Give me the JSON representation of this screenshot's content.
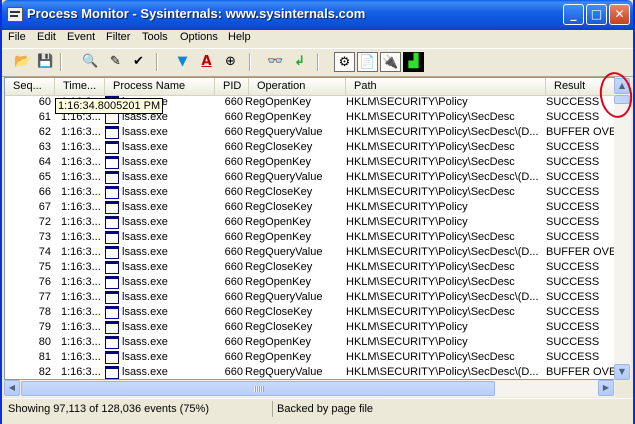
{
  "window": {
    "title": "Process Monitor - Sysinternals: www.sysinternals.com"
  },
  "titlebar": {
    "minimize_glyph": "_",
    "maximize_glyph": "□",
    "close_glyph": "✕"
  },
  "menu": [
    "File",
    "Edit",
    "Event",
    "Filter",
    "Tools",
    "Options",
    "Help"
  ],
  "toolbar": {
    "icons": [
      "open-icon",
      "save-icon",
      "find-icon",
      "highlight-icon",
      "bookmark-icon",
      "filter-icon",
      "highlight-color-icon",
      "target-icon",
      "binoculars-icon",
      "jump-icon",
      "registry-activity-icon",
      "file-activity-icon",
      "network-activity-icon",
      "profiling-activity-icon"
    ],
    "glyphs": [
      "📂",
      "💾",
      "🔍",
      "✎",
      "✔",
      "▼",
      "A",
      "⊕",
      "👓",
      "↲",
      "⚙",
      "📄",
      "🔌",
      "▟"
    ]
  },
  "columns": [
    "Seq...",
    "Time...",
    "Process Name",
    "PID",
    "Operation",
    "Path",
    "Result"
  ],
  "tooltip": "1:16:34.8005201 PM",
  "rows": [
    {
      "seq": "60",
      "time": "1:16:3...",
      "process": "lsass.exe",
      "pid": "660",
      "op": "RegOpenKey",
      "path": "HKLM\\SECURITY\\Policy",
      "result": "SUCCESS"
    },
    {
      "seq": "61",
      "time": "1:16:3...",
      "process": "lsass.exe",
      "pid": "660",
      "op": "RegOpenKey",
      "path": "HKLM\\SECURITY\\Policy\\SecDesc",
      "result": "SUCCESS"
    },
    {
      "seq": "62",
      "time": "1:16:3...",
      "process": "lsass.exe",
      "pid": "660",
      "op": "RegQueryValue",
      "path": "HKLM\\SECURITY\\Policy\\SecDesc\\(D...",
      "result": "BUFFER OVEI"
    },
    {
      "seq": "63",
      "time": "1:16:3...",
      "process": "lsass.exe",
      "pid": "660",
      "op": "RegCloseKey",
      "path": "HKLM\\SECURITY\\Policy\\SecDesc",
      "result": "SUCCESS"
    },
    {
      "seq": "64",
      "time": "1:16:3...",
      "process": "lsass.exe",
      "pid": "660",
      "op": "RegOpenKey",
      "path": "HKLM\\SECURITY\\Policy\\SecDesc",
      "result": "SUCCESS"
    },
    {
      "seq": "65",
      "time": "1:16:3...",
      "process": "lsass.exe",
      "pid": "660",
      "op": "RegQueryValue",
      "path": "HKLM\\SECURITY\\Policy\\SecDesc\\(D...",
      "result": "SUCCESS"
    },
    {
      "seq": "66",
      "time": "1:16:3...",
      "process": "lsass.exe",
      "pid": "660",
      "op": "RegCloseKey",
      "path": "HKLM\\SECURITY\\Policy\\SecDesc",
      "result": "SUCCESS"
    },
    {
      "seq": "67",
      "time": "1:16:3...",
      "process": "lsass.exe",
      "pid": "660",
      "op": "RegCloseKey",
      "path": "HKLM\\SECURITY\\Policy",
      "result": "SUCCESS"
    },
    {
      "seq": "72",
      "time": "1:16:3...",
      "process": "lsass.exe",
      "pid": "660",
      "op": "RegOpenKey",
      "path": "HKLM\\SECURITY\\Policy",
      "result": "SUCCESS"
    },
    {
      "seq": "73",
      "time": "1:16:3...",
      "process": "lsass.exe",
      "pid": "660",
      "op": "RegOpenKey",
      "path": "HKLM\\SECURITY\\Policy\\SecDesc",
      "result": "SUCCESS"
    },
    {
      "seq": "74",
      "time": "1:16:3...",
      "process": "lsass.exe",
      "pid": "660",
      "op": "RegQueryValue",
      "path": "HKLM\\SECURITY\\Policy\\SecDesc\\(D...",
      "result": "BUFFER OVEI"
    },
    {
      "seq": "75",
      "time": "1:16:3...",
      "process": "lsass.exe",
      "pid": "660",
      "op": "RegCloseKey",
      "path": "HKLM\\SECURITY\\Policy\\SecDesc",
      "result": "SUCCESS"
    },
    {
      "seq": "76",
      "time": "1:16:3...",
      "process": "lsass.exe",
      "pid": "660",
      "op": "RegOpenKey",
      "path": "HKLM\\SECURITY\\Policy\\SecDesc",
      "result": "SUCCESS"
    },
    {
      "seq": "77",
      "time": "1:16:3...",
      "process": "lsass.exe",
      "pid": "660",
      "op": "RegQueryValue",
      "path": "HKLM\\SECURITY\\Policy\\SecDesc\\(D...",
      "result": "SUCCESS"
    },
    {
      "seq": "78",
      "time": "1:16:3...",
      "process": "lsass.exe",
      "pid": "660",
      "op": "RegCloseKey",
      "path": "HKLM\\SECURITY\\Policy\\SecDesc",
      "result": "SUCCESS"
    },
    {
      "seq": "79",
      "time": "1:16:3...",
      "process": "lsass.exe",
      "pid": "660",
      "op": "RegCloseKey",
      "path": "HKLM\\SECURITY\\Policy",
      "result": "SUCCESS"
    },
    {
      "seq": "80",
      "time": "1:16:3...",
      "process": "lsass.exe",
      "pid": "660",
      "op": "RegOpenKey",
      "path": "HKLM\\SECURITY\\Policy",
      "result": "SUCCESS"
    },
    {
      "seq": "81",
      "time": "1:16:3...",
      "process": "lsass.exe",
      "pid": "660",
      "op": "RegOpenKey",
      "path": "HKLM\\SECURITY\\Policy\\SecDesc",
      "result": "SUCCESS"
    },
    {
      "seq": "82",
      "time": "1:16:3...",
      "process": "lsass.exe",
      "pid": "660",
      "op": "RegQueryValue",
      "path": "HKLM\\SECURITY\\Policy\\SecDesc\\(D...",
      "result": "BUFFER OVEI"
    }
  ],
  "status": {
    "events": "Showing 97,113 of 128,036 events (75%)",
    "backing": "Backed by page file"
  },
  "scrollbar_glyphs": {
    "up": "▲",
    "down": "▼",
    "left": "◀",
    "right": "▶"
  },
  "colors": {
    "title_blue": "#0a4ed6",
    "annotation_red": "#e0001b",
    "icon_navy": "#000080"
  }
}
